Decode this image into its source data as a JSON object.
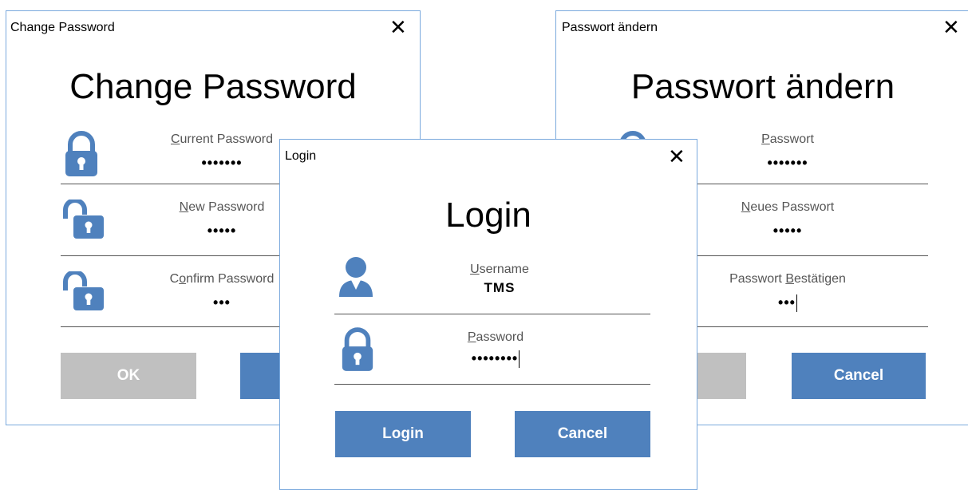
{
  "dialogs": {
    "change_en": {
      "window_title": "Change Password",
      "heading": "Change Password",
      "fields": [
        {
          "label_first": "C",
          "label_rest": "urrent Password",
          "value": "•••••••"
        },
        {
          "label_first": "N",
          "label_rest": "ew Password",
          "value": "•••••"
        },
        {
          "label_first": "C",
          "label_rest": "o",
          "label_tail": "nfirm Password",
          "value": "•••"
        }
      ],
      "ok_label": "OK"
    },
    "login": {
      "window_title": "Login",
      "heading": "Login",
      "username_label_first": "U",
      "username_label_rest": "sername",
      "username_value": "TMS",
      "password_label_first": "P",
      "password_label_rest": "assword",
      "password_value": "••••••••",
      "login_label": "Login",
      "cancel_label": "Cancel"
    },
    "change_de": {
      "window_title": "Passwort ändern",
      "heading": "Passwort ändern",
      "fields": [
        {
          "label_first": "P",
          "label_rest": "asswort",
          "value": "•••••••"
        },
        {
          "label_first": "N",
          "label_rest": "eues Passwort",
          "value": "•••••"
        },
        {
          "label_pre": "Passwort ",
          "label_first": "B",
          "label_rest": "estätigen",
          "value": "•••"
        }
      ],
      "cancel_label": "Cancel"
    }
  },
  "colors": {
    "accent": "#4f81bd",
    "disabled": "#c0c0c0",
    "border": "#7aa9dd"
  },
  "icons": [
    "lock-icon",
    "unlock-icon",
    "user-icon",
    "close-icon"
  ]
}
